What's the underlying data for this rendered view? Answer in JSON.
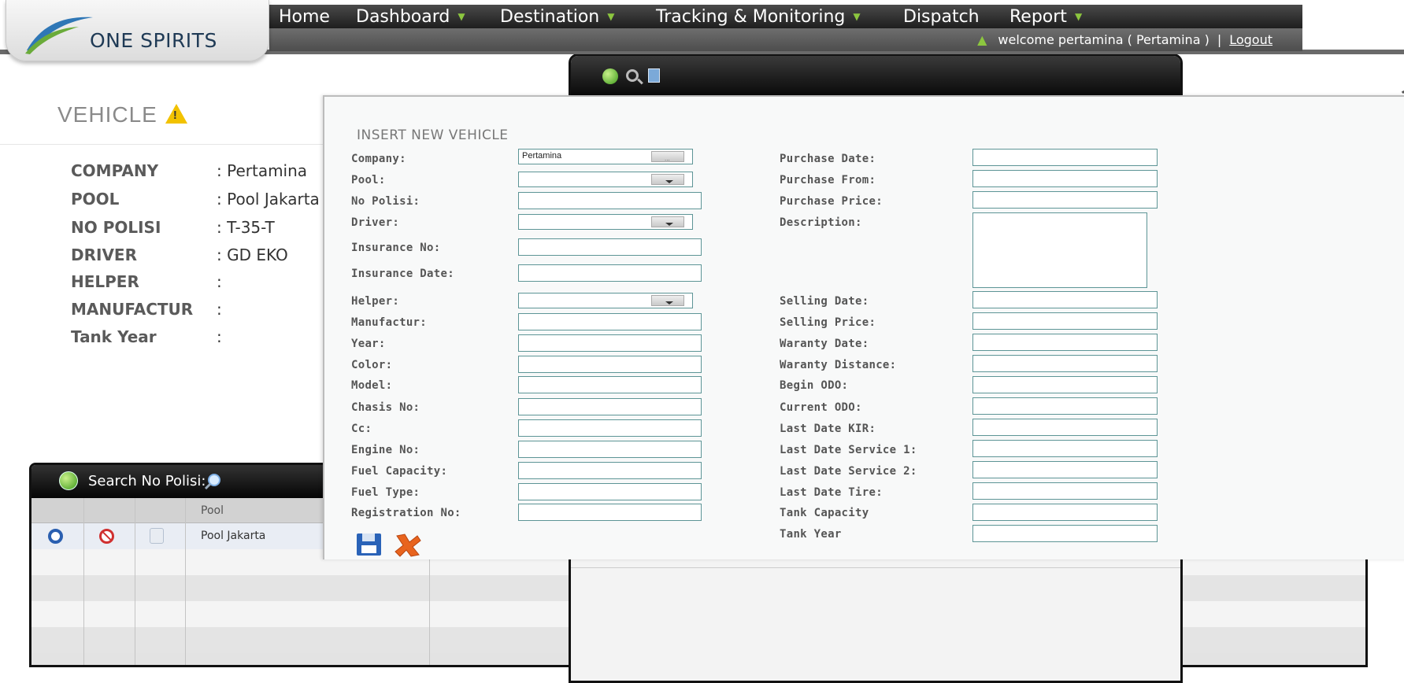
{
  "brand": {
    "name": "ONE SPIRITS"
  },
  "nav": {
    "items": [
      {
        "label": "Home",
        "dropdown": false
      },
      {
        "label": "Dashboard",
        "dropdown": true
      },
      {
        "label": "Destination",
        "dropdown": true
      },
      {
        "label": "Tracking & Monitoring",
        "dropdown": true
      },
      {
        "label": "Dispatch",
        "dropdown": false
      },
      {
        "label": "Report",
        "dropdown": true
      }
    ],
    "welcome_text": "welcome pertamina ( Pertamina )",
    "separator": "|",
    "logout_label": "Logout"
  },
  "vehicle": {
    "title": "VEHICLE",
    "details": [
      {
        "label": "COMPANY",
        "value": ": Pertamina"
      },
      {
        "label": "POOL",
        "value": ": Pool Jakarta"
      },
      {
        "label": "NO POLISI",
        "value": ": T-35-T"
      },
      {
        "label": "DRIVER",
        "value": ": GD EKO"
      },
      {
        "label": "HELPER",
        "value": ":"
      },
      {
        "label": "MANUFACTUR",
        "value": ":"
      },
      {
        "label": "Tank Year",
        "value": ":"
      }
    ]
  },
  "grid": {
    "search_label": "Search No Polisi:",
    "columns": [
      "Pool"
    ],
    "rows": [
      {
        "pool": "Pool Jakarta"
      }
    ]
  },
  "dialog": {
    "title": "INSERT NEW VEHICLE",
    "left_fields": [
      {
        "label": "Company:",
        "type": "lookup",
        "value": "Pertamina"
      },
      {
        "label": "Pool:",
        "type": "select",
        "value": ""
      },
      {
        "label": "No Polisi:",
        "type": "text",
        "value": ""
      },
      {
        "label": "Driver:",
        "type": "select",
        "value": ""
      },
      {
        "label": "Insurance No:",
        "type": "text",
        "value": ""
      },
      {
        "label": "Insurance Date:",
        "type": "text",
        "value": ""
      },
      {
        "label": "Helper:",
        "type": "select",
        "value": ""
      },
      {
        "label": "Manufactur:",
        "type": "text",
        "value": ""
      },
      {
        "label": "Year:",
        "type": "text",
        "value": ""
      },
      {
        "label": "Color:",
        "type": "text",
        "value": ""
      },
      {
        "label": "Model:",
        "type": "text",
        "value": ""
      },
      {
        "label": "Chasis No:",
        "type": "text",
        "value": ""
      },
      {
        "label": "Cc:",
        "type": "text",
        "value": ""
      },
      {
        "label": "Engine No:",
        "type": "text",
        "value": ""
      },
      {
        "label": "Fuel Capacity:",
        "type": "text",
        "value": ""
      },
      {
        "label": "Fuel Type:",
        "type": "text",
        "value": ""
      },
      {
        "label": "Registration No:",
        "type": "text",
        "value": ""
      }
    ],
    "right_fields": [
      {
        "label": "Purchase Date:",
        "type": "text",
        "value": ""
      },
      {
        "label": "Purchase From:",
        "type": "text",
        "value": ""
      },
      {
        "label": "Purchase Price:",
        "type": "text",
        "value": ""
      },
      {
        "label": "Description:",
        "type": "textarea",
        "value": ""
      },
      {
        "label": "Selling Date:",
        "type": "text",
        "value": ""
      },
      {
        "label": "Selling Price:",
        "type": "text",
        "value": ""
      },
      {
        "label": "Waranty Date:",
        "type": "text",
        "value": ""
      },
      {
        "label": "Waranty Distance:",
        "type": "text",
        "value": ""
      },
      {
        "label": "Begin ODO:",
        "type": "text",
        "value": ""
      },
      {
        "label": "Current ODO:",
        "type": "text",
        "value": ""
      },
      {
        "label": "Last Date KIR:",
        "type": "text",
        "value": ""
      },
      {
        "label": "Last Date Service 1:",
        "type": "text",
        "value": ""
      },
      {
        "label": "Last Date Service 2:",
        "type": "text",
        "value": ""
      },
      {
        "label": "Last Date Tire:",
        "type": "text",
        "value": ""
      },
      {
        "label": "Tank Capacity",
        "type": "text",
        "value": ""
      },
      {
        "label": "Tank Year",
        "type": "text",
        "value": ""
      }
    ],
    "actions": {
      "save_icon": "save-icon",
      "cancel_icon": "cancel-icon"
    }
  },
  "colors": {
    "menubar": "#1e1e1e",
    "accent_green": "#8cc63f",
    "field_border": "#5d9596",
    "brand_text": "#1f3a55",
    "save_blue": "#2a63b8",
    "cancel_orange": "#e8641e"
  }
}
